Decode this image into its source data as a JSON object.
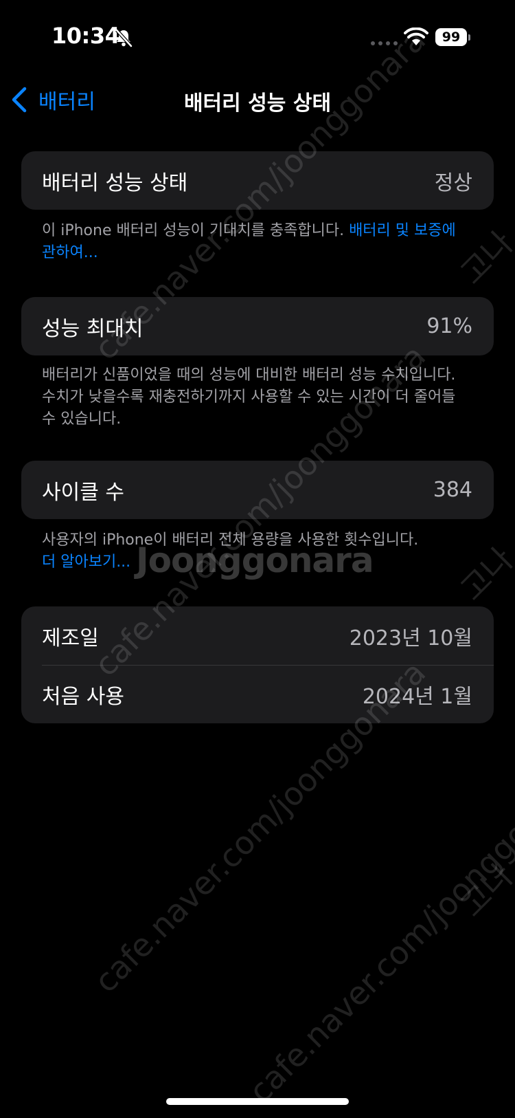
{
  "status_bar": {
    "time": "10:34",
    "battery_level": "99",
    "icons": [
      "bell-slash-icon",
      "cellular-signal-icon",
      "wifi-icon",
      "battery-icon"
    ]
  },
  "nav": {
    "back_label": "배터리",
    "title": "배터리 성능 상태"
  },
  "battery_health": {
    "label": "배터리 성능 상태",
    "value": "정상",
    "footnote_text": "이 iPhone 배터리 성능이 기대치를 충족합니다.",
    "footnote_link": "배터리 및 보증에 관하여..."
  },
  "maximum_capacity": {
    "label": "성능 최대치",
    "value": "91%",
    "footnote_text": "배터리가 신품이었을 때의 성능에 대비한 배터리 성능 수치입니다. 수치가 낮을수록 재충전하기까지 사용할 수 있는 시간이 더 줄어들 수 있습니다."
  },
  "cycle_count": {
    "label": "사이클 수",
    "value": "384",
    "footnote_text": "사용자의 iPhone이 배터리 전체 용량을 사용한 횟수입니다.",
    "footnote_link": "더 알아보기..."
  },
  "dates": {
    "manufactured_label": "제조일",
    "manufactured_value": "2023년 10월",
    "first_use_label": "처음 사용",
    "first_use_value": "2024년 1월"
  },
  "watermark": {
    "url_text": "cafe.naver.com/joonggonara",
    "logo_text": "Joonggonara",
    "side_text": "고나"
  },
  "colors": {
    "background": "#000000",
    "cell": "#1c1c1e",
    "accent": "#0a84ff",
    "secondary_text": "#a2a2a7"
  }
}
